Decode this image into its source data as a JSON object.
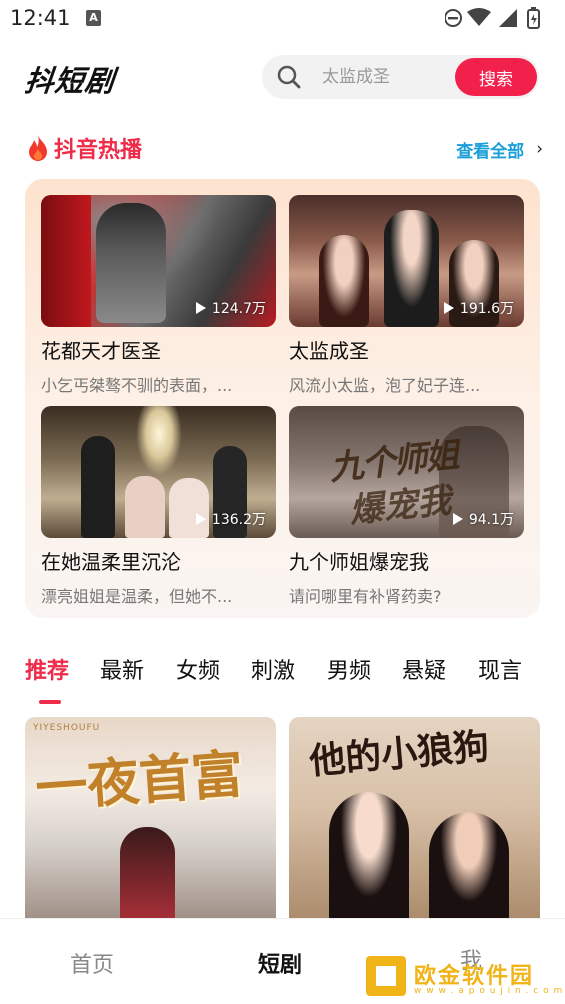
{
  "status_bar": {
    "time": "12:41",
    "notif_glyph": "A"
  },
  "header": {
    "app_title": "抖短剧",
    "search_placeholder": "太监成圣",
    "search_button": "搜索"
  },
  "hot_section": {
    "title": "抖音热播",
    "view_all": "查看全部",
    "items": [
      {
        "title": "花都天才医圣",
        "desc": "小乞丐桀骜不驯的表面，...",
        "plays": "124.7万"
      },
      {
        "title": "太监成圣",
        "desc": "风流小太监，泡了妃子连...",
        "plays": "191.6万"
      },
      {
        "title": "在她温柔里沉沦",
        "desc": "漂亮姐姐是温柔，但她不...",
        "plays": "136.2万"
      },
      {
        "title": "九个师姐爆宠我",
        "desc": "请问哪里有补肾药卖?",
        "plays": "94.1万"
      }
    ]
  },
  "category_tabs": [
    "推荐",
    "最新",
    "女频",
    "刺激",
    "男频",
    "悬疑",
    "现言"
  ],
  "posters": [
    {
      "overlay_text": "一夜首富",
      "sub_text": "YIYESHOUFU"
    },
    {
      "overlay_text": "他的小狼狗",
      "sub_text": ""
    }
  ],
  "bottom_nav": [
    "首页",
    "短剧",
    "我"
  ],
  "watermark": {
    "text": "欧金软件园",
    "url": "w w w . a p o u j i n . c o m"
  },
  "colors": {
    "accent": "#ee2b48",
    "search_button": "#f2214c",
    "link": "#1a9fd8"
  }
}
